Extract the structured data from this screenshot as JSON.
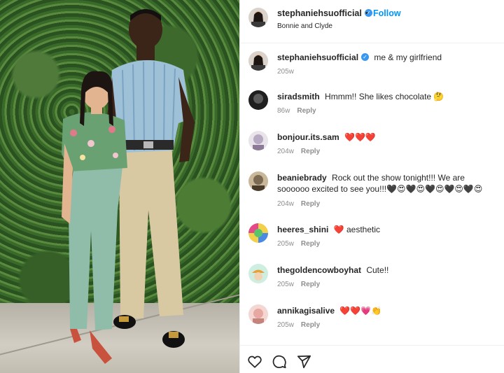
{
  "post": {
    "username": "stephaniehsuofficial",
    "verified_mark": "✓",
    "separator": "•",
    "follow_label": "Follow",
    "location": "Bonnie and Clyde"
  },
  "comments": [
    {
      "username": "stephaniehsuofficial",
      "verified_mark": "✓",
      "text": "me & my girlfriend",
      "time": "205w",
      "reply": ""
    },
    {
      "username": "siradsmith",
      "text": "Hmmm!! She likes chocolate 🤔",
      "time": "86w",
      "reply": "Reply"
    },
    {
      "username": "bonjour.its.sam",
      "text": "❤️❤️❤️",
      "time": "204w",
      "reply": "Reply"
    },
    {
      "username": "beaniebrady",
      "text": "Rock out the show tonight!!! We are soooooo excited to see you!!!🖤😍🖤😍🖤😍🖤😍🖤😍",
      "time": "204w",
      "reply": "Reply"
    },
    {
      "username": "heeres_shini",
      "text": "❤️ aesthetic",
      "time": "205w",
      "reply": "Reply"
    },
    {
      "username": "thegoldencowboyhat",
      "text": "Cute!!",
      "time": "205w",
      "reply": "Reply"
    },
    {
      "username": "annikagisalive",
      "text": "❤️❤️💗👏",
      "time": "205w",
      "reply": "Reply"
    }
  ],
  "icons": {
    "like": "heart-outline",
    "comment": "speech-bubble-outline",
    "share": "paper-plane-outline"
  },
  "colors": {
    "follow": "#0095f6",
    "verified": "#3897f0",
    "meta_text": "#8e8e8e",
    "heart": "#ed1c3a"
  }
}
